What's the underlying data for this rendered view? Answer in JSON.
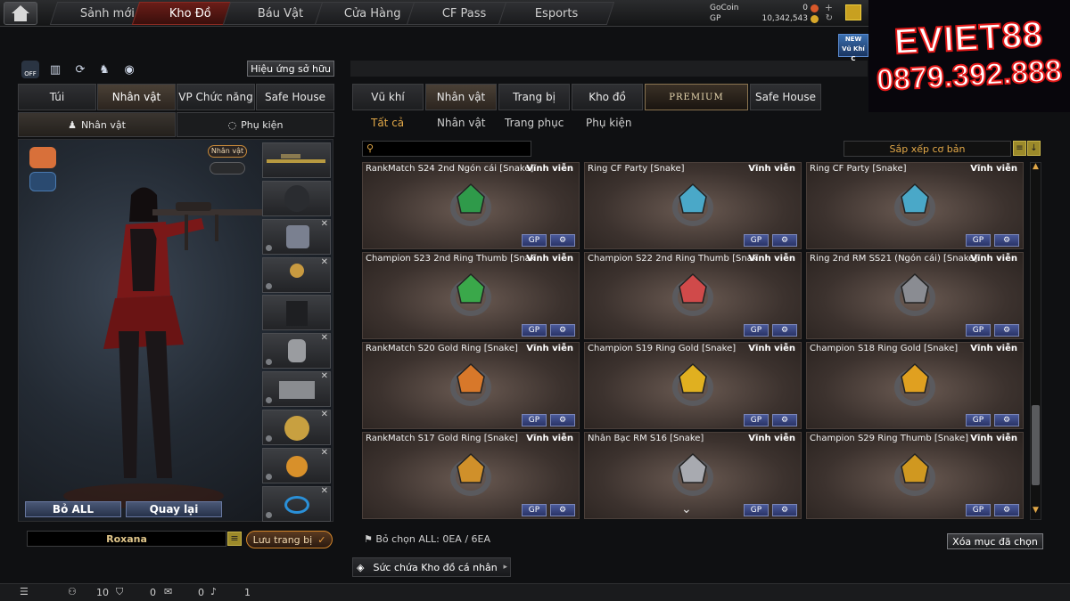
{
  "nav": {
    "tabs": [
      "Sảnh mới",
      "Kho Đồ",
      "Báu Vật",
      "Cửa Hàng",
      "CF Pass",
      "Esports"
    ],
    "active": "Kho Đồ"
  },
  "currency": {
    "gocoin_label": "GoCoin",
    "gocoin_value": "0",
    "gp_label": "GP",
    "gp_value": "10,342,543"
  },
  "ad": {
    "line1": "EVIET88",
    "line2": "0879.392.888"
  },
  "new_badge": {
    "label": "NEW",
    "sub": "Vũ Khí C"
  },
  "left": {
    "effect_button": "Hiệu ứng sở hữu",
    "off_label": "OFF",
    "tabs": [
      "Túi",
      "Nhân vật",
      "VP Chức năng",
      "Safe House"
    ],
    "subtabs": [
      "Nhân vật",
      "Phụ kiện"
    ],
    "char_badge": "Nhân vật",
    "reset_all": "Bỏ ALL",
    "back": "Quay lại",
    "character_name": "Roxana",
    "save": "Lưu trang bị"
  },
  "right": {
    "tabs": [
      "Vũ khí",
      "Nhân vật",
      "Trang bị",
      "Kho đồ",
      "PREMIUM",
      "Safe House"
    ],
    "filters": [
      "Tất cả",
      "Nhân vật",
      "Trang phục",
      "Phụ kiện"
    ],
    "sort_label": "Sắp xếp cơ bản",
    "items": [
      {
        "name": "RankMatch S24 2nd Ngón cái [Snake]",
        "duration": "Vĩnh viễn",
        "color": "#2f9a4a"
      },
      {
        "name": "Ring CF Party [Snake]",
        "duration": "Vĩnh viễn",
        "color": "#4aa8c8"
      },
      {
        "name": "Ring CF Party [Snake]",
        "duration": "Vĩnh viễn",
        "color": "#4aa8c8"
      },
      {
        "name": "Champion S23 2nd Ring Thumb [Snake]",
        "duration": "Vĩnh viễn",
        "color": "#3aa84a"
      },
      {
        "name": "Champion S22 2nd Ring Thumb [Snake]",
        "duration": "Vĩnh viễn",
        "color": "#d04a4a"
      },
      {
        "name": "Ring 2nd RM SS21 (Ngón cái) [Snake]",
        "duration": "Vĩnh viễn",
        "color": "#8a8c92"
      },
      {
        "name": "RankMatch S20 Gold Ring [Snake]",
        "duration": "Vĩnh viễn",
        "color": "#d8782a"
      },
      {
        "name": "Champion S19 Ring Gold [Snake]",
        "duration": "Vĩnh viễn",
        "color": "#e0b020"
      },
      {
        "name": "Champion S18 Ring Gold [Snake]",
        "duration": "Vĩnh viễn",
        "color": "#e0a020"
      },
      {
        "name": "RankMatch S17 Gold Ring [Snake]",
        "duration": "Vĩnh viễn",
        "color": "#d0902a"
      },
      {
        "name": "Nhẫn Bạc RM S16 [Snake]",
        "duration": "Vĩnh viễn",
        "color": "#a8aab0"
      },
      {
        "name": "Champion S29 Ring Thumb [Snake]",
        "duration": "Vĩnh viễn",
        "color": "#d09820"
      }
    ],
    "card_btn1": "GP",
    "selection_text": "Bỏ chọn ALL: 0EA / 6EA",
    "delete_selected": "Xóa mục đã chọn",
    "storage_label": "Sức chứa Kho đồ cá nhân"
  },
  "bottom": {
    "count1": "10",
    "count2": "0",
    "count3": "0",
    "count4": "1"
  },
  "colors": {
    "accent": "#e2a848",
    "active_tab": "#6a1d18",
    "button_blue": "#4a5876"
  }
}
